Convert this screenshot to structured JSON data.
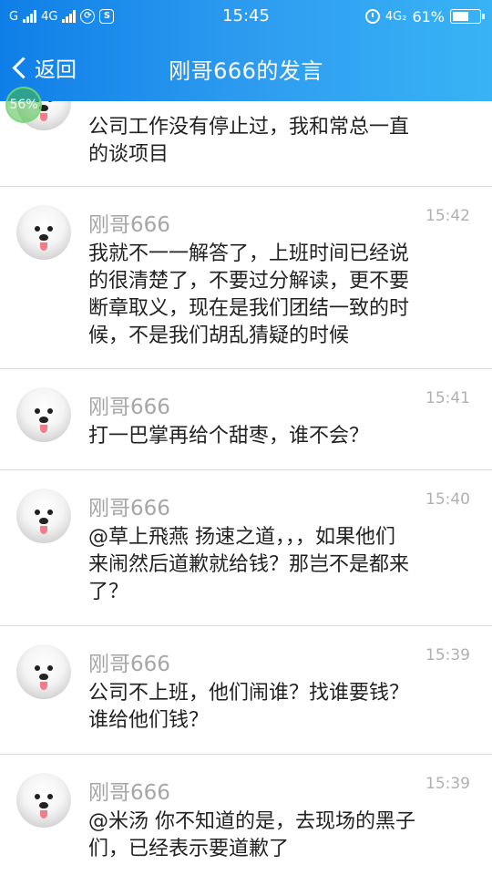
{
  "status_bar": {
    "carrier_left": "G",
    "network": "4G",
    "time": "15:45",
    "network_right": "4G₂",
    "battery": "61%"
  },
  "nav": {
    "back_label": "返回",
    "title": "刚哥666的发言"
  },
  "overlay": {
    "progress_label": "56%"
  },
  "posts": [
    {
      "author": "",
      "time": "",
      "content": "公司工作没有停止过，我和常总一直\n的谈项目"
    },
    {
      "author": "刚哥666",
      "time": "15:42",
      "content": "我就不一一解答了，上班时间已经说\n的很清楚了，不要过分解读，更不要\n断章取义，现在是我们团结一致的时\n候，不是我们胡乱猜疑的时候"
    },
    {
      "author": "刚哥666",
      "time": "15:41",
      "content": "打一巴掌再给个甜枣，谁不会？"
    },
    {
      "author": "刚哥666",
      "time": "15:40",
      "content": "@草上飛燕 扬速之道，，，如果他们\n来闹然后道歉就给钱？那岂不是都来\n了？"
    },
    {
      "author": "刚哥666",
      "time": "15:39",
      "content": "公司不上班，他们闹谁？找谁要钱？\n谁给他们钱？"
    },
    {
      "author": "刚哥666",
      "time": "15:39",
      "content": "@米汤 你不知道的是，去现场的黑子\n们，已经表示要道歉了"
    }
  ]
}
